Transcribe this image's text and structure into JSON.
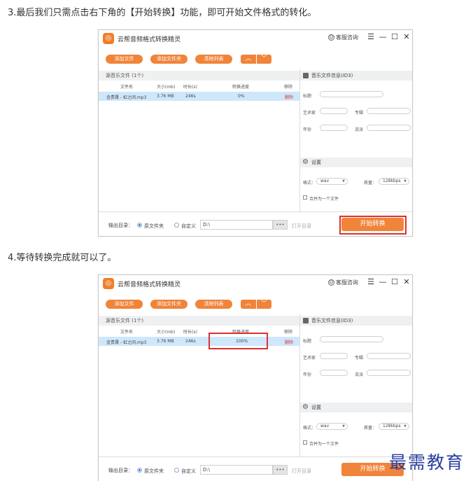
{
  "steps": [
    {
      "text": "3.最后我们只需点击右下角的【开始转换】功能，即可开始文件格式的转化。"
    },
    {
      "text": "4.等待转换完成就可以了。"
    }
  ],
  "app": {
    "title": "云帮音频格式转换精灵",
    "support": "客服咨询",
    "window_controls": {
      "menu": "☰",
      "minimize": "—",
      "maximize": "☐",
      "close": "✕"
    }
  },
  "toolbar": {
    "add_file": "添加文件",
    "add_folder": "添加文件夹",
    "clear_list": "清除列表",
    "up": "︿",
    "down": "﹀"
  },
  "file_list": {
    "header": "源音乐文件 (1个)",
    "columns": [
      "文件名",
      "大小(mb)",
      "时长(s)",
      "转换进度",
      "移除"
    ],
    "rows": [
      {
        "name": "金贵晟 - 虹之间.mp3",
        "size": "3.76 MB",
        "duration": "246s",
        "progress_states": [
          "0%",
          "100%"
        ],
        "remove": "删除"
      }
    ]
  },
  "id3": {
    "header": "音乐文件信息(ID3)",
    "title_label": "标题",
    "artist_label": "艺术家",
    "album_label": "专辑",
    "year_label": "年份",
    "genre_label": "流派"
  },
  "settings": {
    "header": "设置",
    "format_label": "格式：",
    "format_value": "wav",
    "quality_label": "质量：",
    "quality_value": "128kbps",
    "merge_label": "合并为一个文件"
  },
  "footer": {
    "output_label": "输出目录：",
    "source_folder": "原文件夹",
    "custom": "自定义",
    "path": "D:\\",
    "browse": "•••",
    "open_dir": "打开目录",
    "start": "开始转换"
  },
  "watermark": "最需教育",
  "colors": {
    "accent": "#f0843a",
    "highlight": "#e03030",
    "row_selected": "#cfe7fb"
  }
}
